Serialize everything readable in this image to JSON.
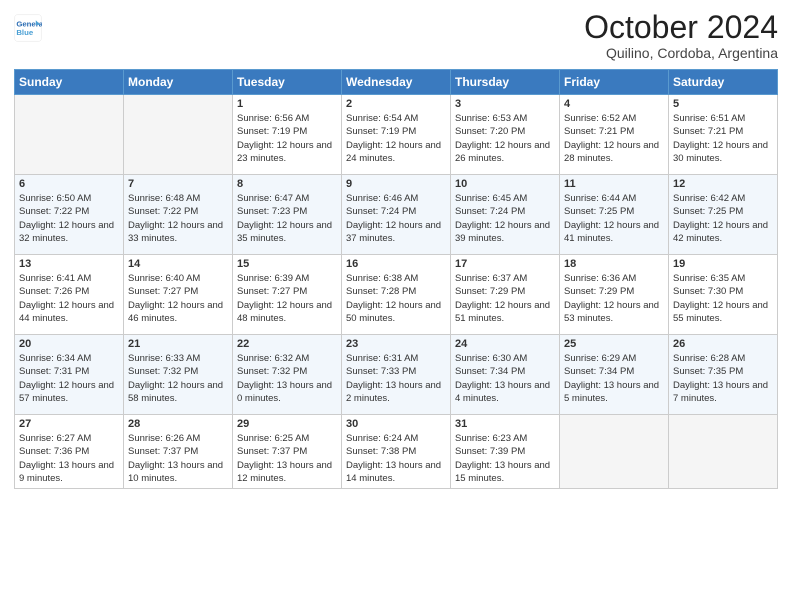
{
  "header": {
    "logo_line1": "General",
    "logo_line2": "Blue",
    "title": "October 2024",
    "subtitle": "Quilino, Cordoba, Argentina"
  },
  "weekdays": [
    "Sunday",
    "Monday",
    "Tuesday",
    "Wednesday",
    "Thursday",
    "Friday",
    "Saturday"
  ],
  "weeks": [
    [
      {
        "day": "",
        "info": ""
      },
      {
        "day": "",
        "info": ""
      },
      {
        "day": "1",
        "info": "Sunrise: 6:56 AM\nSunset: 7:19 PM\nDaylight: 12 hours and 23 minutes."
      },
      {
        "day": "2",
        "info": "Sunrise: 6:54 AM\nSunset: 7:19 PM\nDaylight: 12 hours and 24 minutes."
      },
      {
        "day": "3",
        "info": "Sunrise: 6:53 AM\nSunset: 7:20 PM\nDaylight: 12 hours and 26 minutes."
      },
      {
        "day": "4",
        "info": "Sunrise: 6:52 AM\nSunset: 7:21 PM\nDaylight: 12 hours and 28 minutes."
      },
      {
        "day": "5",
        "info": "Sunrise: 6:51 AM\nSunset: 7:21 PM\nDaylight: 12 hours and 30 minutes."
      }
    ],
    [
      {
        "day": "6",
        "info": "Sunrise: 6:50 AM\nSunset: 7:22 PM\nDaylight: 12 hours and 32 minutes."
      },
      {
        "day": "7",
        "info": "Sunrise: 6:48 AM\nSunset: 7:22 PM\nDaylight: 12 hours and 33 minutes."
      },
      {
        "day": "8",
        "info": "Sunrise: 6:47 AM\nSunset: 7:23 PM\nDaylight: 12 hours and 35 minutes."
      },
      {
        "day": "9",
        "info": "Sunrise: 6:46 AM\nSunset: 7:24 PM\nDaylight: 12 hours and 37 minutes."
      },
      {
        "day": "10",
        "info": "Sunrise: 6:45 AM\nSunset: 7:24 PM\nDaylight: 12 hours and 39 minutes."
      },
      {
        "day": "11",
        "info": "Sunrise: 6:44 AM\nSunset: 7:25 PM\nDaylight: 12 hours and 41 minutes."
      },
      {
        "day": "12",
        "info": "Sunrise: 6:42 AM\nSunset: 7:25 PM\nDaylight: 12 hours and 42 minutes."
      }
    ],
    [
      {
        "day": "13",
        "info": "Sunrise: 6:41 AM\nSunset: 7:26 PM\nDaylight: 12 hours and 44 minutes."
      },
      {
        "day": "14",
        "info": "Sunrise: 6:40 AM\nSunset: 7:27 PM\nDaylight: 12 hours and 46 minutes."
      },
      {
        "day": "15",
        "info": "Sunrise: 6:39 AM\nSunset: 7:27 PM\nDaylight: 12 hours and 48 minutes."
      },
      {
        "day": "16",
        "info": "Sunrise: 6:38 AM\nSunset: 7:28 PM\nDaylight: 12 hours and 50 minutes."
      },
      {
        "day": "17",
        "info": "Sunrise: 6:37 AM\nSunset: 7:29 PM\nDaylight: 12 hours and 51 minutes."
      },
      {
        "day": "18",
        "info": "Sunrise: 6:36 AM\nSunset: 7:29 PM\nDaylight: 12 hours and 53 minutes."
      },
      {
        "day": "19",
        "info": "Sunrise: 6:35 AM\nSunset: 7:30 PM\nDaylight: 12 hours and 55 minutes."
      }
    ],
    [
      {
        "day": "20",
        "info": "Sunrise: 6:34 AM\nSunset: 7:31 PM\nDaylight: 12 hours and 57 minutes."
      },
      {
        "day": "21",
        "info": "Sunrise: 6:33 AM\nSunset: 7:32 PM\nDaylight: 12 hours and 58 minutes."
      },
      {
        "day": "22",
        "info": "Sunrise: 6:32 AM\nSunset: 7:32 PM\nDaylight: 13 hours and 0 minutes."
      },
      {
        "day": "23",
        "info": "Sunrise: 6:31 AM\nSunset: 7:33 PM\nDaylight: 13 hours and 2 minutes."
      },
      {
        "day": "24",
        "info": "Sunrise: 6:30 AM\nSunset: 7:34 PM\nDaylight: 13 hours and 4 minutes."
      },
      {
        "day": "25",
        "info": "Sunrise: 6:29 AM\nSunset: 7:34 PM\nDaylight: 13 hours and 5 minutes."
      },
      {
        "day": "26",
        "info": "Sunrise: 6:28 AM\nSunset: 7:35 PM\nDaylight: 13 hours and 7 minutes."
      }
    ],
    [
      {
        "day": "27",
        "info": "Sunrise: 6:27 AM\nSunset: 7:36 PM\nDaylight: 13 hours and 9 minutes."
      },
      {
        "day": "28",
        "info": "Sunrise: 6:26 AM\nSunset: 7:37 PM\nDaylight: 13 hours and 10 minutes."
      },
      {
        "day": "29",
        "info": "Sunrise: 6:25 AM\nSunset: 7:37 PM\nDaylight: 13 hours and 12 minutes."
      },
      {
        "day": "30",
        "info": "Sunrise: 6:24 AM\nSunset: 7:38 PM\nDaylight: 13 hours and 14 minutes."
      },
      {
        "day": "31",
        "info": "Sunrise: 6:23 AM\nSunset: 7:39 PM\nDaylight: 13 hours and 15 minutes."
      },
      {
        "day": "",
        "info": ""
      },
      {
        "day": "",
        "info": ""
      }
    ]
  ]
}
